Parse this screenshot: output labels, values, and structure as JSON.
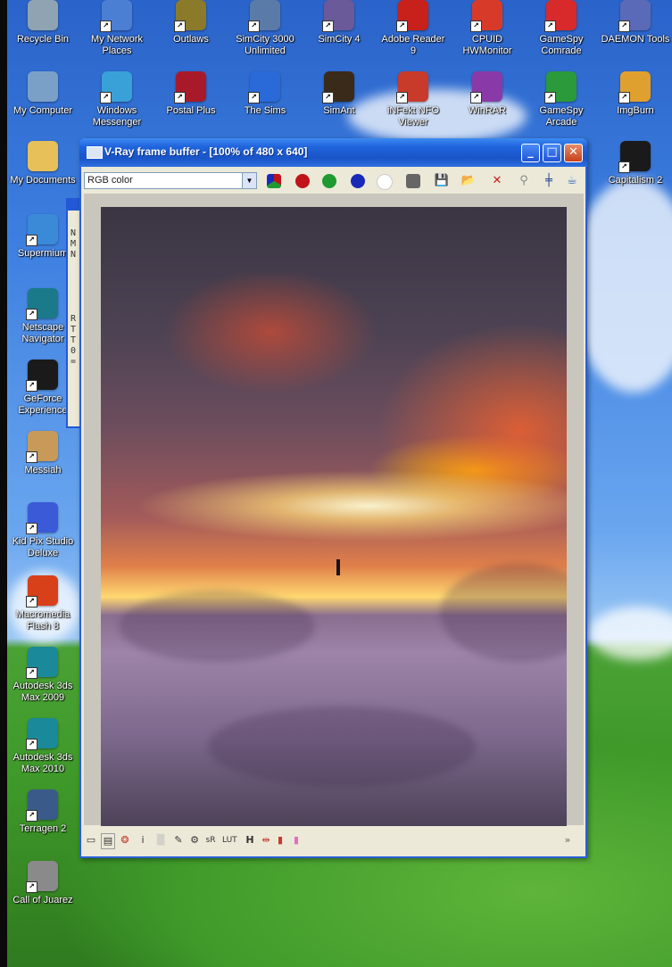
{
  "desktop": {
    "icons": [
      {
        "label": "Recycle Bin",
        "icon": "recycle-bin-icon",
        "color": "#8fa3b3"
      },
      {
        "label": "My Network\nPlaces",
        "icon": "network-places-icon",
        "color": "#4a7fd4"
      },
      {
        "label": "Outlaws",
        "icon": "outlaws-icon",
        "color": "#8a7a2a"
      },
      {
        "label": "SimCity 3000\nUnlimited",
        "icon": "simcity-3000-icon",
        "color": "#5a7aa8"
      },
      {
        "label": "SimCity 4",
        "icon": "simcity-4-icon",
        "color": "#6a5a9a"
      },
      {
        "label": "Adobe Reader\n9",
        "icon": "adobe-reader-icon",
        "color": "#c8201a"
      },
      {
        "label": "CPUID\nHWMonitor",
        "icon": "hwmonitor-icon",
        "color": "#d83a2a"
      },
      {
        "label": "GameSpy\nComrade",
        "icon": "gamespy-comrade-icon",
        "color": "#d82a2a"
      },
      {
        "label": "DAEMON Tools",
        "icon": "daemon-tools-icon",
        "color": "#5a6ab8"
      },
      {
        "label": "My Computer",
        "icon": "my-computer-icon",
        "color": "#7aa0c8"
      },
      {
        "label": "Windows\nMessenger",
        "icon": "messenger-icon",
        "color": "#3aa0d8"
      },
      {
        "label": "Postal Plus",
        "icon": "postal-plus-icon",
        "color": "#a81a2a"
      },
      {
        "label": "The Sims",
        "icon": "the-sims-icon",
        "color": "#2a6ad8"
      },
      {
        "label": "SimAnt",
        "icon": "simant-icon",
        "color": "#3a2a1a"
      },
      {
        "label": "iNFekt NFO\nViewer",
        "icon": "nfo-viewer-icon",
        "color": "#c83a2a"
      },
      {
        "label": "WinRAR",
        "icon": "winrar-icon",
        "color": "#8a3aa8"
      },
      {
        "label": "GameSpy\nArcade",
        "icon": "gamespy-arcade-icon",
        "color": "#2a9a3a"
      },
      {
        "label": "ImgBurn",
        "icon": "imgburn-icon",
        "color": "#e0a030"
      },
      {
        "label": "My Documents",
        "icon": "my-documents-icon",
        "color": "#e8c05a"
      },
      {
        "label": "Capitalism 2",
        "icon": "capitalism-2-icon",
        "color": "#1a1a1a"
      },
      {
        "label": "Supermium",
        "icon": "supermium-icon",
        "color": "#3a8ad8"
      },
      {
        "label": "Netscape\nNavigator",
        "icon": "netscape-icon",
        "color": "#1a7a8a"
      },
      {
        "label": "GeForce\nExperience",
        "icon": "geforce-icon",
        "color": "#1a1a1a"
      },
      {
        "label": "Messiah",
        "icon": "messiah-icon",
        "color": "#c89a5a"
      },
      {
        "label": "Kid Pix Studio\nDeluxe",
        "icon": "kid-pix-icon",
        "color": "#3a5ad8"
      },
      {
        "label": "Macromedia\nFlash 8",
        "icon": "flash-8-icon",
        "color": "#d8401a"
      },
      {
        "label": "Autodesk 3ds\nMax 2009",
        "icon": "3ds-max-2009-icon",
        "color": "#1a8a9a"
      },
      {
        "label": "Autodesk 3ds\nMax 2010",
        "icon": "3ds-max-2010-icon",
        "color": "#1a8a9a"
      },
      {
        "label": "Terragen 2",
        "icon": "terragen-icon",
        "color": "#3a5a8a"
      },
      {
        "label": "Call of Juarez",
        "icon": "call-of-juarez-icon",
        "color": "#8a8a8a"
      }
    ]
  },
  "background_window": {
    "chars": "N\nM\nN\n\n\n\n\n\nR\nT\nT\n0\n="
  },
  "vray": {
    "title": "V-Ray frame buffer - [100% of 480 x 640]",
    "channel_value": "RGB color",
    "colors": {
      "title_bar": "#1f63dc",
      "red": "#c0141a",
      "green": "#1e9a30",
      "blue": "#1a2ab8"
    },
    "toolbar_icons": [
      "show-rgb-icon",
      "red-channel-icon",
      "green-channel-icon",
      "blue-channel-icon",
      "alpha-channel-icon",
      "mono-icon",
      "save-icon",
      "open-icon",
      "clear-icon",
      "track-mouse-icon",
      "region-render-icon",
      "teapot-render-icon"
    ],
    "status_icons": [
      "window-icon",
      "pixel-info-icon",
      "color-corrections-icon",
      "info-icon",
      "show-corrections-icon",
      "lens-icon",
      "srgb-icon",
      "lut-icon",
      "histogram-icon",
      "levels-icon",
      "history-icon",
      "expand-icon"
    ]
  }
}
